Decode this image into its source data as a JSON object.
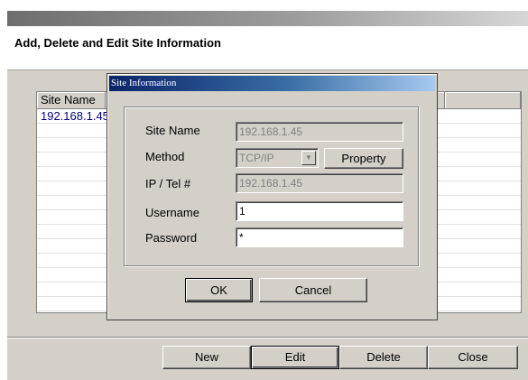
{
  "page": {
    "title": "Add, Delete and Edit Site Information"
  },
  "list": {
    "columns": [
      "Site Name",
      "",
      ""
    ],
    "rows": [
      "192.168.1.45",
      "",
      "",
      "",
      "",
      "",
      "",
      "",
      "",
      "",
      "",
      "",
      "",
      ""
    ]
  },
  "buttons": {
    "new": "New",
    "edit": "Edit",
    "delete": "Delete",
    "close": "Close"
  },
  "dialog": {
    "title": "Site Information",
    "site_name": {
      "label": "Site Name",
      "value": "192.168.1.45"
    },
    "method": {
      "label": "Method",
      "value": "TCP/IP",
      "arrow_icon": "chevron-down-icon"
    },
    "property_label": "Property",
    "ip": {
      "label": "IP / Tel #",
      "value": "192.168.1.45"
    },
    "username": {
      "label": "Username",
      "value": "1"
    },
    "password": {
      "label": "Password",
      "value": "*"
    },
    "ok_label": "OK",
    "cancel_label": "Cancel"
  },
  "colors": {
    "dialog_title_start": "#0a246a",
    "dialog_title_end": "#a6caf0",
    "face": "#d4d0c8",
    "list_text": "#000080"
  }
}
